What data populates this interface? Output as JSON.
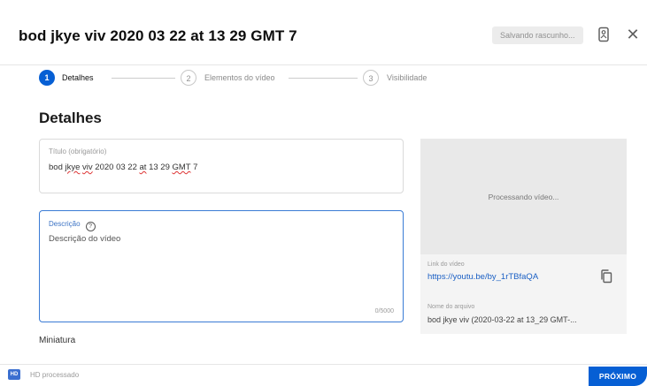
{
  "header": {
    "title": "bod jkye viv 2020 03 22 at 13 29 GMT 7",
    "save_status": "Salvando rascunho...",
    "close_glyph": "✕"
  },
  "stepper": {
    "steps": [
      {
        "number": "1",
        "label": "Detalhes",
        "active": true
      },
      {
        "number": "2",
        "label": "Elementos do vídeo",
        "active": false
      },
      {
        "number": "3",
        "label": "Visibilidade",
        "active": false
      }
    ]
  },
  "details": {
    "section_title": "Detalhes",
    "title_field": {
      "label": "Título (obrigatório)",
      "value_parts": [
        "bod ",
        "jkye",
        " ",
        "viv",
        " 2020 03 22 ",
        "at",
        " 13 29 ",
        "GMT",
        " 7"
      ]
    },
    "description_field": {
      "label": "Descrição",
      "help_glyph": "?",
      "placeholder": "Descrição do vídeo",
      "counter": "0/5000"
    },
    "thumbnail_label": "Miniatura"
  },
  "preview": {
    "processing_text": "Processando vídeo...",
    "link_label": "Link do vídeo",
    "link_value": "https://youtu.be/by_1rTBfaQA",
    "filename_label": "Nome do arquivo",
    "filename_value": "bod jkye viv (2020-03-22 at 13_29 GMT-..."
  },
  "footer": {
    "hd_badge": "HD",
    "status": "HD processado",
    "next_label": "PRÓXIMO"
  },
  "colors": {
    "accent": "#065fd4",
    "link": "#1a5fc4",
    "focus_border": "#3a7bd5"
  }
}
